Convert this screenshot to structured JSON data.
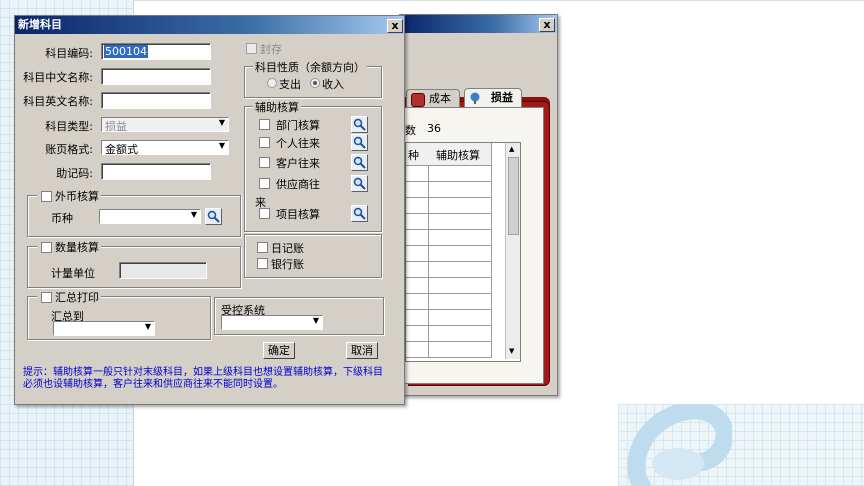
{
  "dialog": {
    "title": "新增科目",
    "close_label": "x",
    "fields": {
      "code_label": "科目编码:",
      "code_value": "500104",
      "cn_name_label": "科目中文名称:",
      "cn_name_value": "",
      "en_name_label": "科目英文名称:",
      "en_name_value": "",
      "type_label": "科目类型:",
      "type_value": "损益",
      "format_label": "账页格式:",
      "format_value": "金额式",
      "mnemonic_label": "助记码:",
      "mnemonic_value": ""
    },
    "seal_label": "封存",
    "direction": {
      "title": "科目性质（余额方向）",
      "expense_label": "支出",
      "income_label": "收入",
      "selected": "收入"
    },
    "aux": {
      "title": "辅助核算",
      "items": [
        {
          "label": "部门核算"
        },
        {
          "label": "个人往来"
        },
        {
          "label": "客户往来"
        },
        {
          "label": "供应商往",
          "wrap": "来"
        },
        {
          "label": "项目核算"
        }
      ]
    },
    "foreign": {
      "title": "外币核算",
      "currency_label": "币种",
      "currency_value": ""
    },
    "quantity": {
      "title": "数量核算",
      "unit_label": "计量单位",
      "unit_value": ""
    },
    "journal": {
      "diary_label": "日记账",
      "bank_label": "银行账"
    },
    "summary": {
      "title": "汇总打印",
      "to_label": "汇总到",
      "to_value": ""
    },
    "controlled": {
      "title": "受控系统",
      "value": ""
    },
    "ok_label": "确定",
    "cancel_label": "取消",
    "hint": "提示：辅助核算一般只针对末级科目，如果上级科目也想设置辅助核算，下级科目必须也设辅助核算，客户往来和供应商往来不能同时设置。"
  },
  "background_window": {
    "close_label": "x",
    "tabs": [
      {
        "label": "成本",
        "icon": "cost-tab-icon"
      },
      {
        "label": "损益",
        "icon": "profit-loss-tab-icon",
        "active": true
      }
    ],
    "count_prefix": "数",
    "count_value": "36",
    "columns": [
      "种",
      "辅助核算"
    ]
  },
  "colors": {
    "titlebar_start": "#0a246a",
    "titlebar_end": "#a6caf0",
    "hint_text": "#0000cc",
    "book_red": "#8b1010"
  }
}
